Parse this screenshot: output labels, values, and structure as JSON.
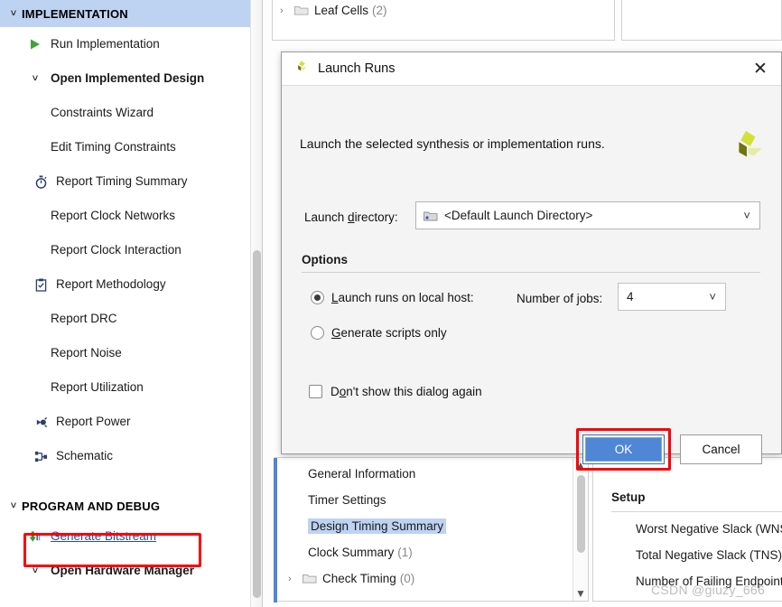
{
  "flow_navigator": {
    "sections": [
      {
        "id": "implementation",
        "label": "IMPLEMENTATION",
        "active": true,
        "items": [
          {
            "label": "Run Implementation",
            "icon": "green-play-icon",
            "indent": 1,
            "bold": false
          },
          {
            "label": "Open Implemented Design",
            "icon": "chevron-down-icon",
            "indent": 1,
            "bold": true
          },
          {
            "label": "Constraints Wizard",
            "icon": "none",
            "indent": 2,
            "bold": false
          },
          {
            "label": "Edit Timing Constraints",
            "icon": "none",
            "indent": 2,
            "bold": false
          },
          {
            "label": "Report Timing Summary",
            "icon": "stopwatch-icon",
            "indent": 2,
            "bold": false
          },
          {
            "label": "Report Clock Networks",
            "icon": "none",
            "indent": 2,
            "bold": false
          },
          {
            "label": "Report Clock Interaction",
            "icon": "none",
            "indent": 2,
            "bold": false
          },
          {
            "label": "Report Methodology",
            "icon": "clipboard-check-icon",
            "indent": 2,
            "bold": false
          },
          {
            "label": "Report DRC",
            "icon": "none",
            "indent": 2,
            "bold": false
          },
          {
            "label": "Report Noise",
            "icon": "none",
            "indent": 2,
            "bold": false
          },
          {
            "label": "Report Utilization",
            "icon": "none",
            "indent": 2,
            "bold": false
          },
          {
            "label": "Report Power",
            "icon": "power-plug-icon",
            "indent": 2,
            "bold": false
          },
          {
            "label": "Schematic",
            "icon": "schematic-icon",
            "indent": 2,
            "bold": false
          }
        ]
      },
      {
        "id": "program-and-debug",
        "label": "PROGRAM AND DEBUG",
        "active": false,
        "items": [
          {
            "label": "Generate Bitstream",
            "icon": "generate-bitstream-icon",
            "indent": 1,
            "bold": false,
            "link": true,
            "highlighted": true
          },
          {
            "label": "Open Hardware Manager",
            "icon": "chevron-down-icon",
            "indent": 1,
            "bold": true
          }
        ]
      }
    ]
  },
  "background": {
    "netlist_tree": [
      {
        "label": "Leaf Cells",
        "count": "(2)",
        "twisty": ">",
        "folder": true
      }
    ],
    "timing_tree": [
      {
        "label": "General Information",
        "count": "",
        "twisty": "",
        "folder": false,
        "selected": false
      },
      {
        "label": "Timer Settings",
        "count": "",
        "twisty": "",
        "folder": false,
        "selected": false
      },
      {
        "label": "Design Timing Summary",
        "count": "",
        "twisty": "",
        "folder": false,
        "selected": true
      },
      {
        "label": "Clock Summary",
        "count": "(1)",
        "twisty": "",
        "folder": false,
        "selected": false
      },
      {
        "label": "Check Timing",
        "count": "(0)",
        "twisty": ">",
        "folder": true,
        "selected": false
      }
    ],
    "setup_panel": {
      "title": "Setup",
      "rows": [
        "Worst Negative Slack (WNS):",
        "Total Negative Slack (TNS):",
        "Number of Failing Endpoints:"
      ]
    },
    "watermark": "CSDN @giuzy_666"
  },
  "dialog": {
    "title": "Launch Runs",
    "close_label": "✕",
    "description": "Launch the selected synthesis or implementation runs.",
    "launch_directory": {
      "label_pre": "Launch ",
      "label_mnemonic": "d",
      "label_post": "irectory:",
      "value": "<Default Launch Directory>"
    },
    "options_label": "Options",
    "radios": [
      {
        "id": "launch-local-host",
        "pre": "",
        "mnemonic": "L",
        "post": "aunch runs on local host:",
        "selected": true
      },
      {
        "id": "generate-scripts-only",
        "pre": "",
        "mnemonic": "G",
        "post": "enerate scripts only",
        "selected": false
      }
    ],
    "jobs": {
      "label": "Number of jobs:",
      "value": "4"
    },
    "dont_show": {
      "pre": "D",
      "mnemonic": "o",
      "post": "n't show this dialog again",
      "checked": false
    },
    "buttons": {
      "ok": "OK",
      "cancel": "Cancel"
    }
  },
  "colors": {
    "selection_blue": "#bed3f2",
    "annotation_red": "#fb0007",
    "ok_blue": "#4f86d6",
    "link_blue": "#2a4f9e",
    "play_green": "#3aa53a",
    "icon_navy": "#2c3e72",
    "logo_bright": "#d4e03a",
    "logo_dark": "#6e7410",
    "logo_pale": "#e4eda0"
  }
}
